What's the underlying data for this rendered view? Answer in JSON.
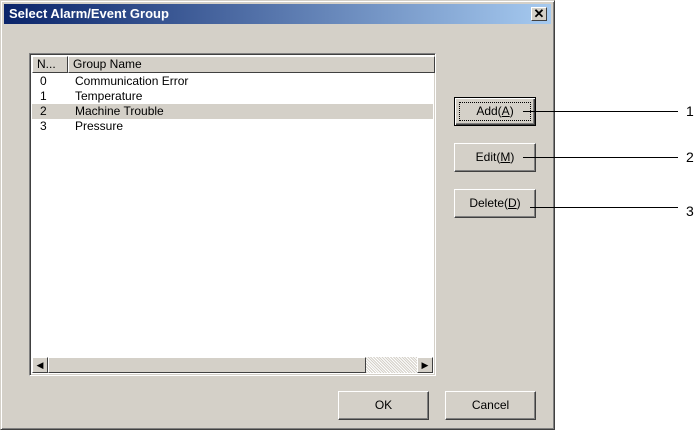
{
  "dialog": {
    "title": "Select Alarm/Event Group",
    "close_glyph": "✕"
  },
  "listview": {
    "columns": [
      {
        "label": "N..."
      },
      {
        "label": "Group Name"
      }
    ],
    "rows": [
      {
        "no": "0",
        "name": "Communication Error",
        "selected": false
      },
      {
        "no": "1",
        "name": "Temperature",
        "selected": false
      },
      {
        "no": "2",
        "name": "Machine Trouble",
        "selected": true
      },
      {
        "no": "3",
        "name": "Pressure",
        "selected": false
      }
    ],
    "scroll_left_glyph": "◀",
    "scroll_right_glyph": "▶"
  },
  "buttons": {
    "add": {
      "prefix": "Add(",
      "mnemonic": "A",
      "suffix": ")"
    },
    "edit": {
      "prefix": "Edit(",
      "mnemonic": "M",
      "suffix": ")"
    },
    "delete": {
      "prefix": "Delete(",
      "mnemonic": "D",
      "suffix": ")"
    },
    "ok": "OK",
    "cancel": "Cancel"
  },
  "callouts": [
    "1",
    "2",
    "3"
  ],
  "colors": {
    "title_start": "#0a246a",
    "title_end": "#a6caf0",
    "dialog_face": "#d4d0c8"
  }
}
